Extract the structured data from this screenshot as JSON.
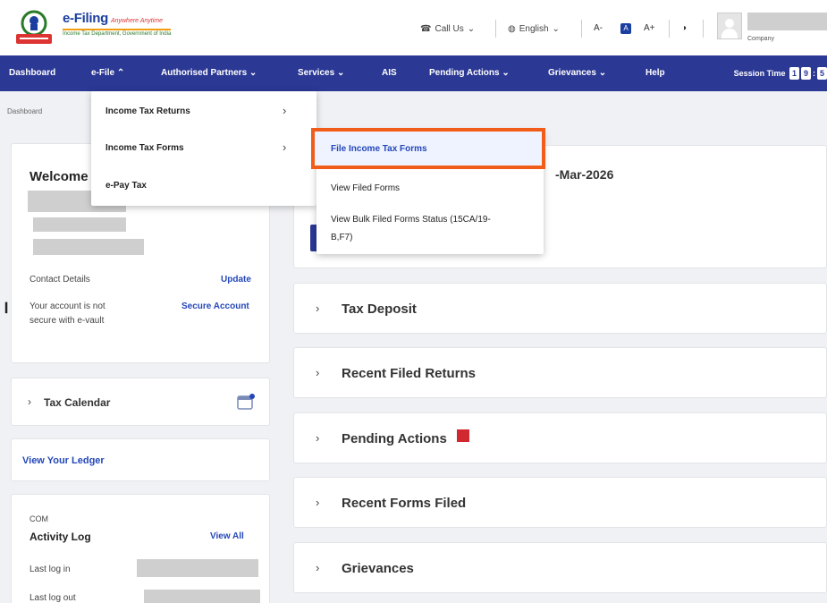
{
  "header": {
    "brand": "e-Filing",
    "brand_tagline": "Anywhere Anytime",
    "brand_subtitle": "Income Tax Department, Government of India",
    "call_us": "Call Us",
    "language": "English",
    "font_decrease": "A-",
    "font_normal": "A",
    "font_increase": "A+",
    "contrast_icon": "contrast-icon",
    "user_type": "Company"
  },
  "nav": {
    "items": [
      "Dashboard",
      "e-File",
      "Authorised Partners",
      "Services",
      "AIS",
      "Pending Actions",
      "Grievances",
      "Help"
    ],
    "session_label": "Session Time",
    "session_digits": [
      "1",
      "9",
      ":",
      "5"
    ]
  },
  "breadcrumb": "Dashboard",
  "efile_menu": {
    "items": [
      "Income Tax Returns",
      "Income Tax Forms",
      "e-Pay Tax"
    ]
  },
  "forms_submenu": {
    "items": [
      "File Income Tax Forms",
      "View Filed Forms",
      "View Bulk Filed Forms Status (15CA/19-",
      "B,F7)"
    ]
  },
  "welcome": {
    "title": "Welcome",
    "contact_label": "Contact Details",
    "update_link": "Update",
    "account_msg_1": "Your account is not",
    "account_msg_2": "secure with e-vault",
    "secure_link": "Secure Account"
  },
  "tax_calendar": {
    "label": "Tax Calendar"
  },
  "ledger": {
    "label": "View Your Ledger"
  },
  "activity": {
    "type": "COM",
    "title": "Activity Log",
    "view_all": "View All",
    "last_login": "Last log in",
    "last_logout": "Last log out"
  },
  "main": {
    "date_fragment": "-Mar-2026",
    "accordions": [
      "Tax Deposit",
      "Recent Filed Returns",
      "Pending Actions",
      "Recent Forms Filed",
      "Grievances"
    ]
  },
  "colors": {
    "nav_bg": "#2b3894",
    "highlight": "#f25c19",
    "link": "#2447b8",
    "pending_badge": "#d0282e"
  }
}
